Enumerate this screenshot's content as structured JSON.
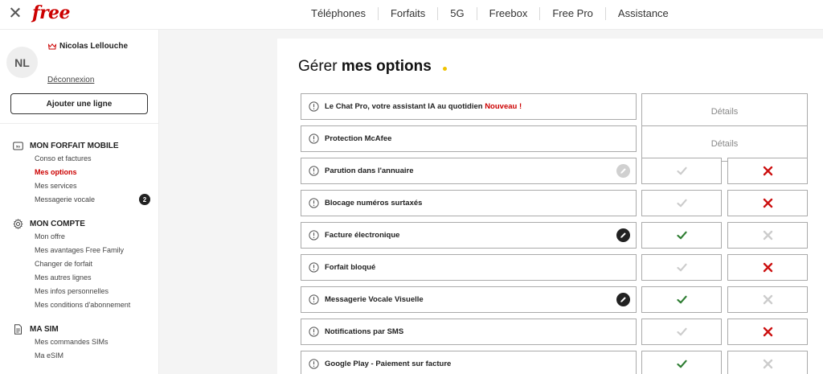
{
  "header": {
    "logo": "free",
    "nav": [
      "Téléphones",
      "Forfaits",
      "5G",
      "Freebox",
      "Free Pro",
      "Assistance"
    ]
  },
  "sidebar": {
    "avatar_initials": "NL",
    "user_name": "Nicolas Lellouche",
    "logout": "Déconnexion",
    "add_line": "Ajouter une ligne",
    "sections": [
      {
        "title": "MON FORFAIT MOBILE",
        "icon": "sim-card-icon",
        "items": [
          {
            "label": "Conso et factures"
          },
          {
            "label": "Mes options",
            "active": true
          },
          {
            "label": "Mes services"
          },
          {
            "label": "Messagerie vocale",
            "badge": "2"
          }
        ]
      },
      {
        "title": "MON COMPTE",
        "icon": "gear-icon",
        "items": [
          {
            "label": "Mon offre"
          },
          {
            "label": "Mes avantages Free Family"
          },
          {
            "label": "Changer de forfait"
          },
          {
            "label": "Mes autres lignes"
          },
          {
            "label": "Mes infos personnelles"
          },
          {
            "label": "Mes conditions d'abonnement"
          }
        ]
      },
      {
        "title": "MA SIM",
        "icon": "document-icon",
        "items": [
          {
            "label": "Mes commandes SIMs"
          },
          {
            "label": "Ma eSIM"
          }
        ]
      }
    ]
  },
  "main": {
    "title_light": "Gérer ",
    "title_bold": "mes options",
    "details_label": "Détails",
    "rows": [
      {
        "label": "Le Chat Pro, votre assistant IA au quotidien",
        "tag": "Nouveau !",
        "type": "details"
      },
      {
        "label": "Protection McAfee",
        "type": "details"
      },
      {
        "label": "Parution dans l'annuaire",
        "type": "toggle",
        "enabled": false,
        "edit": "light"
      },
      {
        "label": "Blocage numéros surtaxés",
        "type": "toggle",
        "enabled": false
      },
      {
        "label": "Facture électronique",
        "type": "toggle",
        "enabled": true,
        "edit": "dark"
      },
      {
        "label": "Forfait bloqué",
        "type": "toggle",
        "enabled": false
      },
      {
        "label": "Messagerie Vocale Visuelle",
        "type": "toggle",
        "enabled": true,
        "edit": "dark"
      },
      {
        "label": "Notifications par SMS",
        "type": "toggle",
        "enabled": false
      },
      {
        "label": "Google Play - Paiement sur facture",
        "type": "toggle",
        "enabled": true
      }
    ],
    "colors": {
      "accent": "#cc0000",
      "check_on": "#2e7d32",
      "check_off": "#cccccc",
      "cross_on": "#cc1111",
      "cross_off": "#cccccc",
      "dot": "#f0c300"
    }
  }
}
